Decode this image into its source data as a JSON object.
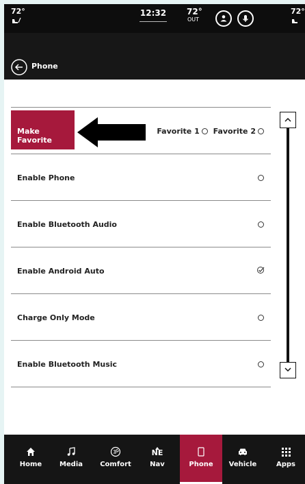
{
  "status_bar": {
    "left_temp": "72°",
    "time": "12:32",
    "outside_temp": "72°",
    "outside_label": "OUT",
    "right_temp": "72°",
    "icons": [
      "heated-seat-icon",
      "driver-profile-icon",
      "voice-mic-icon",
      "heated-seat-icon"
    ]
  },
  "header": {
    "title": "Phone",
    "back_icon": "back-arrow-icon"
  },
  "list": {
    "favorite_row": {
      "button_label": "Make Favorite",
      "option1": "Favorite 1",
      "option2": "Favorite 2"
    },
    "rows": [
      {
        "label": "Enable Phone",
        "state": "off"
      },
      {
        "label": "Enable Bluetooth Audio",
        "state": "off"
      },
      {
        "label": "Enable Android Auto",
        "state": "checked"
      },
      {
        "label": "Charge Only Mode",
        "state": "off"
      },
      {
        "label": "Enable Bluetooth Music",
        "state": "off"
      }
    ]
  },
  "nav": {
    "items": [
      {
        "label": "Home",
        "icon": "home-icon"
      },
      {
        "label": "Media",
        "icon": "music-note-icon"
      },
      {
        "label": "Comfort",
        "icon": "climate-icon"
      },
      {
        "label": "Nav",
        "icon": "compass-icon",
        "heading": "NE"
      },
      {
        "label": "Phone",
        "icon": "phone-icon",
        "active": true
      },
      {
        "label": "Vehicle",
        "icon": "car-icon"
      },
      {
        "label": "Apps",
        "icon": "grid-icon"
      }
    ]
  },
  "colors": {
    "accent": "#a6193c",
    "bar": "#151515",
    "background": "#ffffff"
  }
}
